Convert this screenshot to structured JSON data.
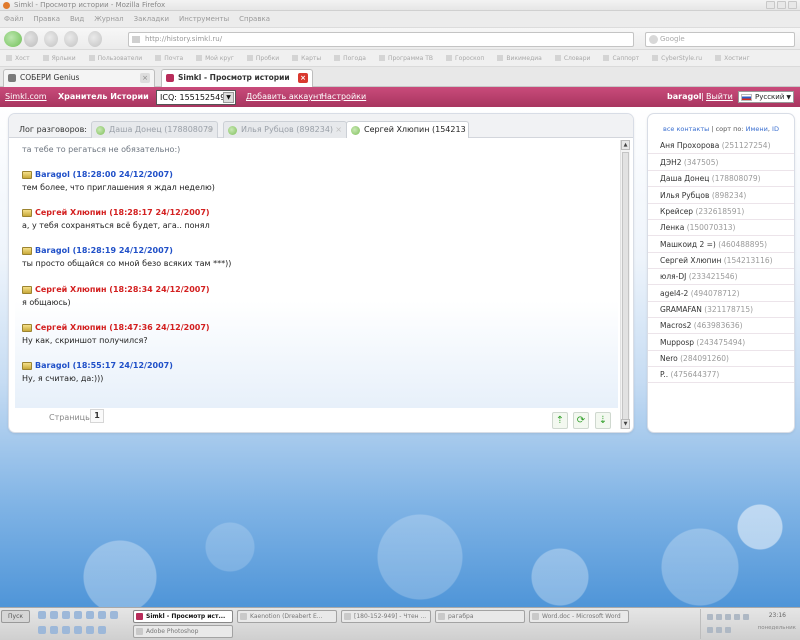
{
  "browser": {
    "window_title": "Simkl - Просмотр истории - Mozilla Firefox",
    "menu": [
      "Файл",
      "Правка",
      "Вид",
      "Журнал",
      "Закладки",
      "Инструменты",
      "Справка"
    ],
    "url": "http://history.simkl.ru/",
    "search_placeholder": "Google",
    "bookmarks": [
      "Хост",
      "Ярлыки",
      "Пользователи",
      "Почта",
      "Мой круг",
      "Пробки",
      "Карты",
      "Погода",
      "Программа ТВ",
      "Гороскоп",
      "Викимедиа",
      "Словари",
      "Саппорт",
      "CyberStyle.ru",
      "Хостинг"
    ],
    "tabs": [
      {
        "label": "СОБЕРИ Genius",
        "active": false
      },
      {
        "label": "Simkl - Просмотр истории",
        "active": true
      }
    ]
  },
  "header": {
    "brand": "Simkl.com",
    "title": "Хранитель Истории",
    "icq_account": "ICQ: 155152549",
    "add_account": "Добавить аккаунт",
    "settings": "Настройки",
    "username": "baragol",
    "separator": "|",
    "exit": "Выйти",
    "language": "Русский"
  },
  "chat": {
    "log_label": "Лог разговоров:",
    "tabs": [
      {
        "name": "Даша Донец",
        "uin": "(178808079",
        "active": false
      },
      {
        "name": "Илья Рубцов",
        "uin": "(898234)",
        "active": false
      },
      {
        "name": "Сергей Хлюпин",
        "uin": "(154213",
        "active": true
      }
    ],
    "truncated_line": "та тебе то регаться не обязательно:)",
    "messages": [
      {
        "author": "Baragol",
        "time": "(18:28:00 24/12/2007)",
        "text": "тем более, что приглашения я ждал неделю)",
        "side": "self"
      },
      {
        "author": "Сергей Хлюпин",
        "time": "(18:28:17 24/12/2007)",
        "text": "а, у тебя сохраняться всё будет, ага.. понял",
        "side": "other"
      },
      {
        "author": "Baragol",
        "time": "(18:28:19 24/12/2007)",
        "text": "ты просто общайся со мной безо всяких там ***))",
        "side": "self"
      },
      {
        "author": "Сергей Хлюпин",
        "time": "(18:28:34 24/12/2007)",
        "text": "я общаюсь)",
        "side": "other"
      },
      {
        "author": "Сергей Хлюпин",
        "time": "(18:47:36 24/12/2007)",
        "text": "Ну как, скриншот получился?",
        "side": "other"
      },
      {
        "author": "Baragol",
        "time": "(18:55:17 24/12/2007)",
        "text": "Ну, я считаю, да:)))",
        "side": "self"
      }
    ],
    "pages_label": "Страницы:",
    "current_page": "1",
    "actions": {
      "up": "⇡",
      "refresh": "⟳",
      "down": "⇣"
    }
  },
  "contacts": {
    "all_label": "все контакты",
    "sort_label": "сорт по:",
    "sort_name": "Имени",
    "sort_id": "ID",
    "list": [
      {
        "name": "Аня Прохорова",
        "uin": "(251127254)"
      },
      {
        "name": "ДЭН2",
        "uin": "(347505)"
      },
      {
        "name": "Даша Донец",
        "uin": "(178808079)"
      },
      {
        "name": "Илья Рубцов",
        "uin": "(898234)"
      },
      {
        "name": "Крейсер",
        "uin": "(232618591)"
      },
      {
        "name": "Ленка",
        "uin": "(150070313)"
      },
      {
        "name": "Машкоид 2 =)",
        "uin": "(460488895)"
      },
      {
        "name": "Сергей Хлюпин",
        "uin": "(154213116)"
      },
      {
        "name": "юля-DJ",
        "uin": "(233421546)"
      },
      {
        "name": "agel4-2",
        "uin": "(494078712)"
      },
      {
        "name": "GRAMAFAN",
        "uin": "(321178715)"
      },
      {
        "name": "Macros2",
        "uin": "(463983636)"
      },
      {
        "name": "Mupposp",
        "uin": "(243475494)"
      },
      {
        "name": "Nero",
        "uin": "(284091260)"
      },
      {
        "name": "P..",
        "uin": "(475644377)"
      }
    ]
  },
  "taskbar": {
    "start": "Пуск",
    "tasks": [
      "Simkl - Просмотр ист...",
      "Kaenotion (Dreabert E...",
      "[180-152-949] - Чтен ...",
      "рагабра",
      "Word.doc - Microsoft Word",
      "Adobe Photoshop"
    ],
    "clock": "23:16",
    "date": "понедельник"
  },
  "colors": {
    "brand_pink": "#b83f69",
    "self_author": "#2050c8",
    "other_author": "#d32020"
  }
}
